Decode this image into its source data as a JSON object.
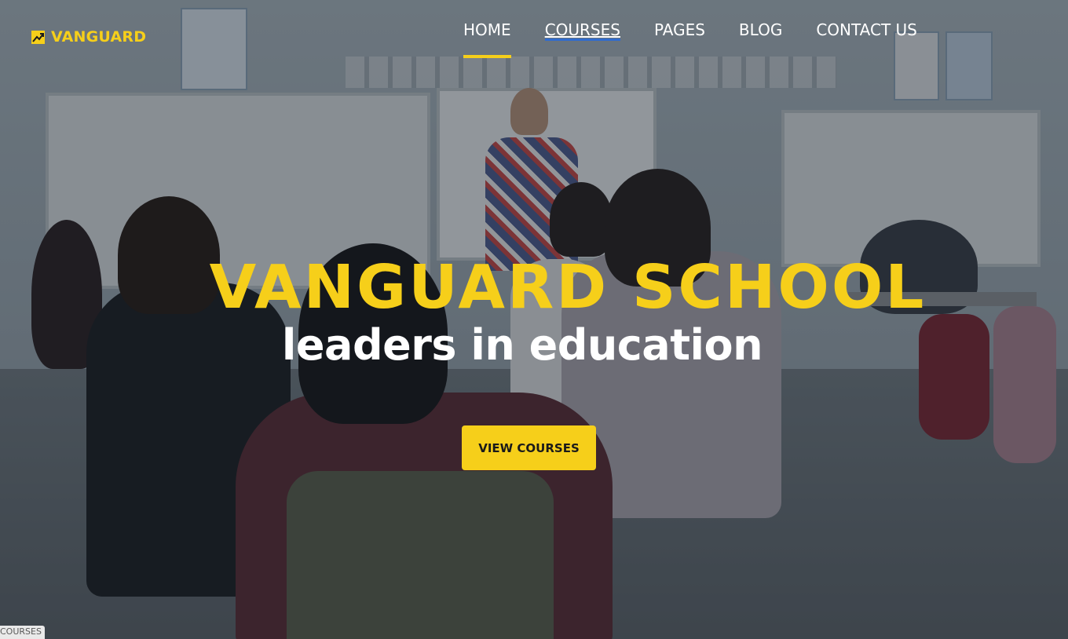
{
  "brand": {
    "name": "VANGUARD",
    "icon": "trending-up-icon",
    "color": "#f6cf1a"
  },
  "nav": {
    "items": [
      {
        "label": "HOME",
        "state": "active"
      },
      {
        "label": "COURSES",
        "state": "hover"
      },
      {
        "label": "PAGES",
        "state": "normal"
      },
      {
        "label": "BLOG",
        "state": "normal"
      },
      {
        "label": "CONTACT US",
        "state": "normal"
      }
    ],
    "active_color": "#f6cf1a"
  },
  "hero": {
    "title": "VANGUARD SCHOOL",
    "subtitle": "leaders in education",
    "cta_label": "VIEW COURSES",
    "cta_color": "#f6cf1a"
  },
  "status_bar": {
    "link_preview": "COURSES"
  }
}
